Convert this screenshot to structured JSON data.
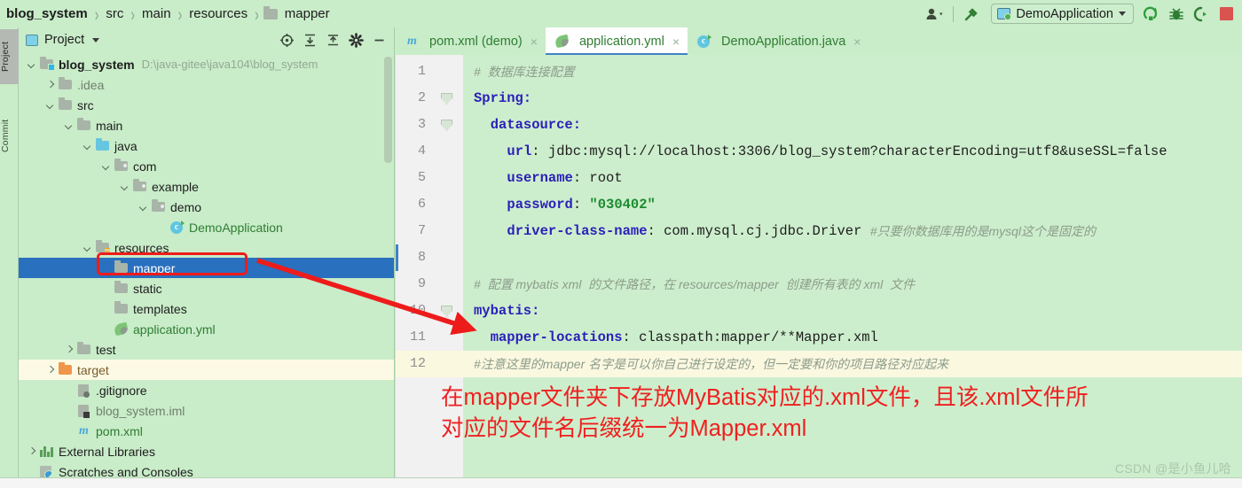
{
  "breadcrumb": {
    "items": [
      {
        "label": "blog_system",
        "icon": "none",
        "root": true
      },
      {
        "label": "src",
        "icon": "none"
      },
      {
        "label": "main",
        "icon": "none"
      },
      {
        "label": "resources",
        "icon": "none"
      },
      {
        "label": "mapper",
        "icon": "folder-icon"
      }
    ],
    "separator": "›"
  },
  "toolbar": {
    "user_icon": "user-account-icon",
    "build_icon": "hammer-build-icon",
    "run_config": {
      "label": "DemoApplication",
      "icon": "run-config-icon",
      "caret": "chevron-down-icon"
    },
    "run_icon": "run-icon",
    "debug_icon": "debug-bug-icon",
    "coverage_icon": "run-with-coverage-icon",
    "stop_icon": "stop-icon"
  },
  "vertical_tabs": [
    {
      "label": "Project",
      "active": true
    },
    {
      "label": "Commit",
      "active": false
    }
  ],
  "project_panel": {
    "title": "Project",
    "caret": "chevron-down-icon",
    "header_icons": [
      {
        "name": "locate-icon"
      },
      {
        "name": "expand-all-icon"
      },
      {
        "name": "collapse-all-icon"
      },
      {
        "name": "settings-gear-icon"
      },
      {
        "name": "hide-panel-icon"
      }
    ],
    "tree": [
      {
        "label": "blog_system",
        "path": "D:\\java-gitee\\java104\\blog_system",
        "indent": 0,
        "twist": "down",
        "icon": "module-folder-icon",
        "style": "bold"
      },
      {
        "label": ".idea",
        "indent": 1,
        "twist": "right",
        "icon": "folder-icon",
        "style": "gray"
      },
      {
        "label": "src",
        "indent": 1,
        "twist": "down",
        "icon": "folder-icon",
        "style": "normal"
      },
      {
        "label": "main",
        "indent": 2,
        "twist": "down",
        "icon": "folder-icon",
        "style": "normal"
      },
      {
        "label": "java",
        "indent": 3,
        "twist": "down",
        "icon": "sources-folder-icon",
        "style": "normal"
      },
      {
        "label": "com",
        "indent": 4,
        "twist": "down",
        "icon": "package-folder-icon",
        "style": "normal"
      },
      {
        "label": "example",
        "indent": 5,
        "twist": "down",
        "icon": "package-folder-icon",
        "style": "normal"
      },
      {
        "label": "demo",
        "indent": 6,
        "twist": "down",
        "icon": "package-folder-icon",
        "style": "normal"
      },
      {
        "label": "DemoApplication",
        "indent": 7,
        "twist": "none",
        "icon": "java-class-icon",
        "style": "green"
      },
      {
        "label": "resources",
        "indent": 3,
        "twist": "down",
        "icon": "resources-folder-icon",
        "style": "normal"
      },
      {
        "label": "mapper",
        "indent": 4,
        "twist": "none",
        "icon": "folder-icon",
        "style": "normal",
        "selected": true,
        "highlighted": true
      },
      {
        "label": "static",
        "indent": 4,
        "twist": "none",
        "icon": "folder-icon",
        "style": "normal"
      },
      {
        "label": "templates",
        "indent": 4,
        "twist": "none",
        "icon": "folder-icon",
        "style": "normal"
      },
      {
        "label": "application.yml",
        "indent": 4,
        "twist": "none",
        "icon": "spring-yaml-icon",
        "style": "green"
      },
      {
        "label": "test",
        "indent": 2,
        "twist": "right",
        "icon": "folder-icon",
        "style": "normal"
      },
      {
        "label": "target",
        "indent": 1,
        "twist": "right",
        "icon": "excluded-folder-icon",
        "style": "orange",
        "row_highlight": true
      },
      {
        "label": ".gitignore",
        "indent": 2,
        "twist": "none",
        "icon": "ignored-file-icon",
        "style": "normal"
      },
      {
        "label": "blog_system.iml",
        "indent": 2,
        "twist": "none",
        "icon": "module-file-icon",
        "style": "gray"
      },
      {
        "label": "pom.xml",
        "indent": 2,
        "twist": "none",
        "icon": "maven-icon",
        "style": "green"
      },
      {
        "label": "External Libraries",
        "indent": 0,
        "twist": "right",
        "icon": "libraries-icon",
        "style": "normal"
      },
      {
        "label": "Scratches and Consoles",
        "indent": 0,
        "twist": "none",
        "icon": "scratches-icon",
        "style": "normal"
      }
    ]
  },
  "editor": {
    "tabs": [
      {
        "label": "pom.xml (demo)",
        "icon": "maven-icon",
        "close": "×",
        "active": false
      },
      {
        "label": "application.yml",
        "icon": "spring-yaml-icon",
        "close": "×",
        "active": true
      },
      {
        "label": "DemoApplication.java",
        "icon": "java-class-icon",
        "close": "×",
        "active": false
      }
    ],
    "current_line": 12,
    "lines": [
      {
        "num": "1",
        "fold": false,
        "segments": [
          {
            "t": "#  数据库连接配置",
            "c": "cmt-cn",
            "indent": 0
          }
        ]
      },
      {
        "num": "2",
        "fold": true,
        "segments": [
          {
            "t": "Spring:",
            "c": "key",
            "indent": 0
          }
        ]
      },
      {
        "num": "3",
        "fold": true,
        "segments": [
          {
            "t": "datasource:",
            "c": "key",
            "indent": 1
          }
        ]
      },
      {
        "num": "4",
        "fold": false,
        "segments": [
          {
            "t": "url",
            "c": "key",
            "indent": 2
          },
          {
            "t": ": jdbc:mysql://localhost:3306/blog_system?characterEncoding=utf8&useSSL=false",
            "c": "val"
          }
        ]
      },
      {
        "num": "5",
        "fold": false,
        "segments": [
          {
            "t": "username",
            "c": "key",
            "indent": 2
          },
          {
            "t": ": root",
            "c": "val"
          }
        ]
      },
      {
        "num": "6",
        "fold": false,
        "segments": [
          {
            "t": "password",
            "c": "key",
            "indent": 2
          },
          {
            "t": ": ",
            "c": "val"
          },
          {
            "t": "\"030402\"",
            "c": "str"
          }
        ]
      },
      {
        "num": "7",
        "fold": false,
        "segments": [
          {
            "t": "driver-class-name",
            "c": "key",
            "indent": 2
          },
          {
            "t": ": com.mysql.cj.jdbc.Driver ",
            "c": "val"
          },
          {
            "t": "#只要你数据库用的是mysql这个是固定的",
            "c": "cmt-cn"
          }
        ]
      },
      {
        "num": "8",
        "fold": false,
        "segments": []
      },
      {
        "num": "9",
        "fold": false,
        "segments": [
          {
            "t": "#  配置 mybatis xml  的文件路径，在 resources/mapper  创建所有表的 xml  文件",
            "c": "cmt-cn",
            "indent": 0
          }
        ]
      },
      {
        "num": "10",
        "fold": true,
        "segments": [
          {
            "t": "mybatis:",
            "c": "key",
            "indent": 0
          }
        ]
      },
      {
        "num": "11",
        "fold": false,
        "segments": [
          {
            "t": "mapper-locations",
            "c": "key",
            "indent": 1
          },
          {
            "t": ": classpath:mapper/**Mapper.xml",
            "c": "val"
          }
        ]
      },
      {
        "num": "12",
        "fold": false,
        "current": true,
        "segments": [
          {
            "t": "#注意这里的mapper 名字是可以你自己进行设定的，但一定要和你的项目路径对应起来",
            "c": "cmt-cn",
            "indent": 0
          }
        ]
      }
    ]
  },
  "annotation": {
    "text": "在mapper文件夹下存放MyBatis对应的.xml文件，且该.xml文件所\n对应的文件名后缀统一为Mapper.xml",
    "color": "#ef2020",
    "arrow": {
      "name": "red-arrow-annotation",
      "color": "#ee1b1b"
    },
    "highlight_box": {
      "name": "red-highlight-box",
      "color": "#ee1b1b"
    }
  },
  "watermark": {
    "text": "CSDN @是小鱼儿哈"
  },
  "colors": {
    "background": "#c9ecc9",
    "editor_bg": "#cdeecd",
    "gutter_bg": "#f1f1f1",
    "selection_blue": "#2970bf",
    "current_line": "#fbf8e0",
    "annotation_red": "#ef2020",
    "keyword_blue": "#2a1fb8",
    "string_green": "#1a8a2e",
    "comment_gray": "#8b9c8b"
  }
}
